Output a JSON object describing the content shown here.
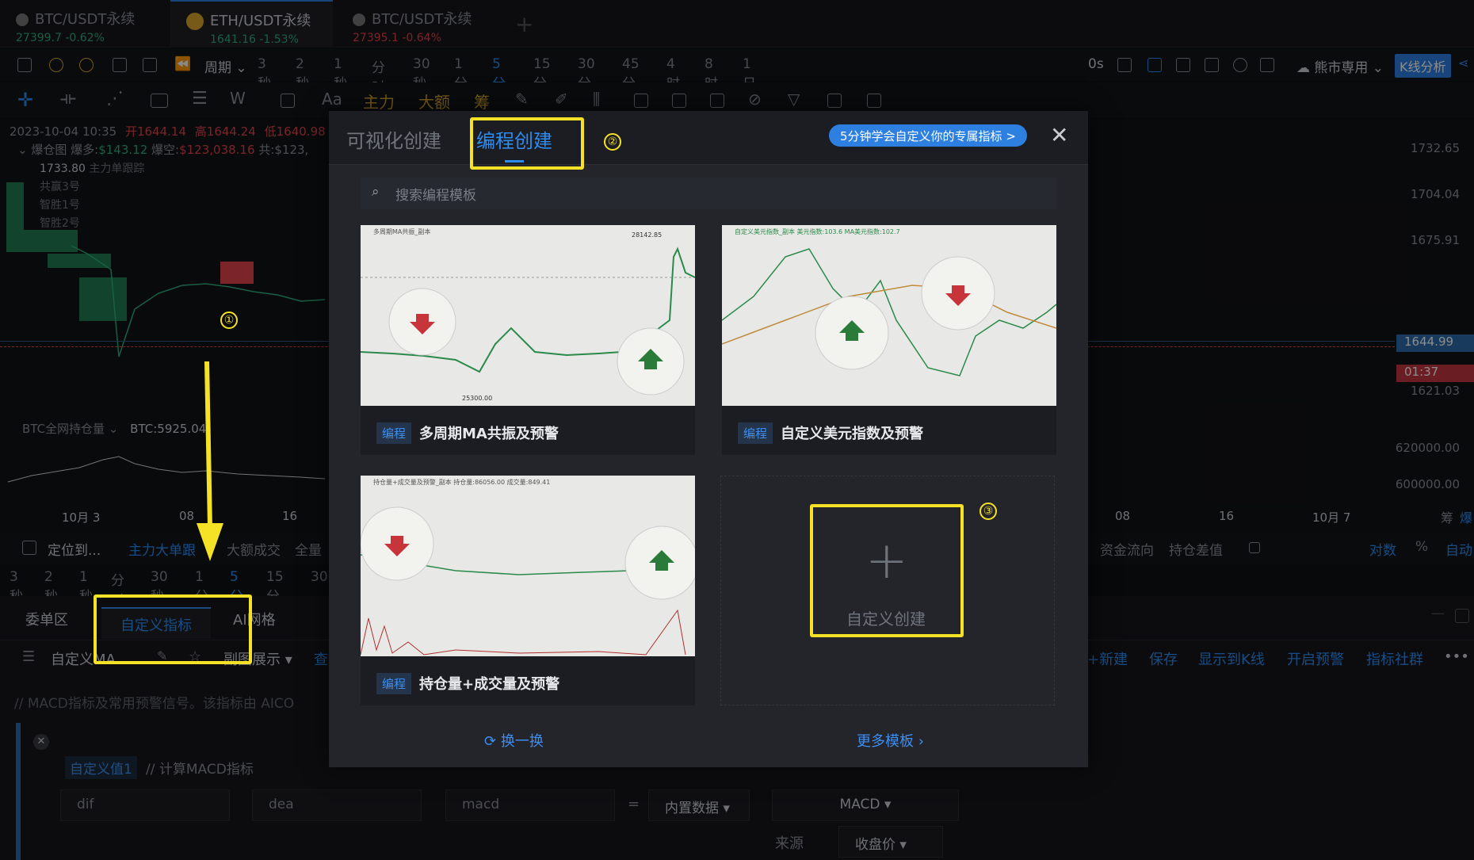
{
  "tabs": [
    {
      "name": "BTC/USDT永续",
      "price": "27399.7",
      "change": "-0.62%"
    },
    {
      "name": "ETH/USDT永续",
      "price": "1641.16",
      "change": "-1.53%"
    },
    {
      "name": "BTC/USDT永续",
      "price": "27395.1",
      "change": "-0.64%"
    }
  ],
  "toolbar": {
    "period_label": "周期",
    "intervals": [
      "3秒",
      "2秒",
      "1秒",
      "分时",
      "30秒",
      "1分",
      "5分",
      "15分",
      "30分",
      "45分",
      "4时",
      "8时",
      "1日"
    ],
    "active_interval": "5分",
    "latency": "0s",
    "theme": "熊市専用",
    "kline_analysis": "K线分析"
  },
  "drawing_tools": [
    "Aa",
    "主力",
    "大额",
    "筹"
  ],
  "chart": {
    "info_line": "2023-10-04 10:35  开 1644.14  高 1644.24  低 1640.98",
    "info_open_label": "开",
    "info_open": "1644.14",
    "info_high_label": "高",
    "info_high": "1644.24",
    "info_low_label": "低",
    "info_low": "1640.98",
    "info_time": "2023-10-04 10:35",
    "liq_label": "爆仓图",
    "liq_long_label": "爆多:",
    "liq_long": "$143.12",
    "liq_short_label": "爆空:",
    "liq_short": "$123,038.16",
    "liq_total_label": "共:",
    "liq_total": "$123,",
    "price_marker": "1733.80",
    "trackers": [
      "主力单跟踪",
      "共赢3号",
      "智胜1号",
      "智胜2号"
    ],
    "price_axis": [
      "1732.65",
      "1704.04",
      "1675.91",
      "1621.03"
    ],
    "current_price": "1644.99",
    "countdown": "01:37",
    "sub_indicator": "BTC全网持仓量",
    "sub_value": "BTC:5925",
    "sub_value_tail": ".04",
    "sub_axis": [
      "620000.00",
      "600000.00"
    ],
    "time_axis_left": [
      "10月 3",
      "08",
      "16"
    ],
    "time_axis_right": [
      "08",
      "16",
      "10月 7"
    ],
    "right_edge": [
      "筹",
      "爆"
    ]
  },
  "bottom_bar": {
    "locate": "定位到...",
    "items": [
      "主力大单跟",
      "大额成交",
      "全量"
    ],
    "right_items": [
      "资金流向",
      "持仓差值"
    ],
    "log": "对数",
    "percent": "%",
    "auto": "自动",
    "intervals": [
      "3秒",
      "2秒",
      "1秒",
      "分时",
      "30秒",
      "1分",
      "5分",
      "15分",
      "30"
    ],
    "active_interval": "5分"
  },
  "panel": {
    "tabs": [
      "委单区",
      "自定义指标",
      "AI网格"
    ],
    "active_tab": "自定义指标",
    "sub_left": "自定义MA",
    "display": "副图展示",
    "query": "查",
    "actions": [
      "+新建",
      "保存",
      "显示到K线",
      "开启预警",
      "指标社群"
    ],
    "more": "•••",
    "comment": "// MACD指标及常用预警信号。该指标由 AICO",
    "var_name": "自定义值1",
    "var_comment": "// 计算MACD指标",
    "fields": [
      "dif",
      "dea",
      "macd"
    ],
    "equals": "=",
    "builtin": "内置数据",
    "macd_select": "MACD",
    "source_label": "来源",
    "source_value": "收盘价"
  },
  "modal": {
    "tab_visual": "可视化创建",
    "tab_code": "编程创建",
    "promo": "5分钟学会自定义你的专属指标 >",
    "close": "✕",
    "search_placeholder": "搜索编程模板",
    "cards": [
      {
        "tag": "编程",
        "title": "多周期MA共振及预警",
        "thumb_label": "多周期MA共振_副本",
        "thumb_hi": "28142.85",
        "thumb_lo": "25300.00"
      },
      {
        "tag": "编程",
        "title": "自定义美元指数及预警",
        "thumb_label": "自定义美元指数_副本  美元指数:103.6  MA美元指数:102.7"
      },
      {
        "tag": "编程",
        "title": "持仓量+成交量及预警",
        "thumb_label": "持仓量+成交量及预警_副本  持仓量:86056.00  成交量:849.41"
      }
    ],
    "create_custom": "自定义创建",
    "refresh": "换一换",
    "more_templates": "更多模板"
  },
  "annotations": [
    "①",
    "②",
    "③"
  ],
  "colors": {
    "accent": "#2d8cf0",
    "up": "#2fae7a",
    "down": "#e0424b",
    "highlight": "#f5e126"
  }
}
